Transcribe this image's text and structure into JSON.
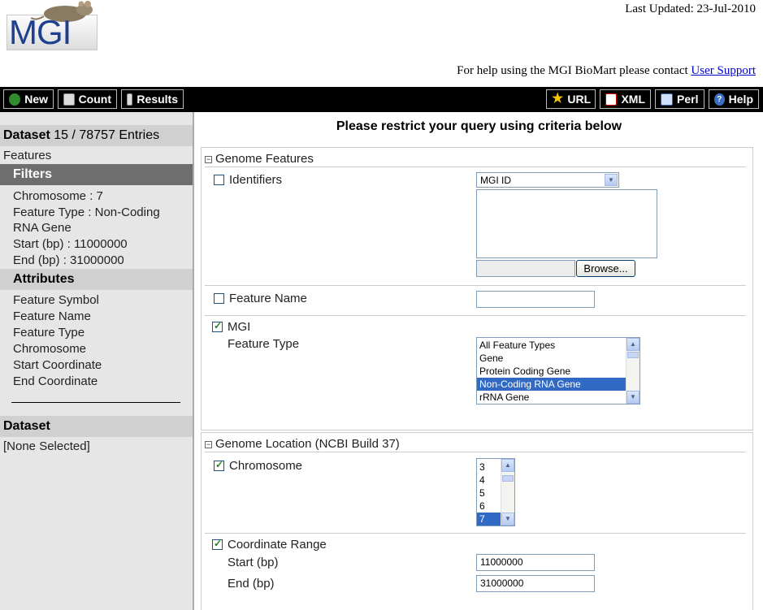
{
  "header": {
    "logo_text": "MGI",
    "last_updated": "Last Updated: 23-Jul-2010",
    "help_prefix": "For help using the MGI BioMart please contact",
    "help_link": "User Support"
  },
  "toolbar": {
    "new": "New",
    "count": "Count",
    "results": "Results",
    "url": "URL",
    "xml": "XML",
    "perl": "Perl",
    "help": "Help"
  },
  "sidebar": {
    "dataset_label": "Dataset",
    "dataset_count": "15 / 78757 Entries",
    "dataset_name": "Features",
    "filters_header": "Filters",
    "filters": [
      "Chromosome : 7",
      "Feature Type : Non-Coding",
      "RNA Gene",
      "Start (bp) : 11000000",
      "End (bp) : 31000000"
    ],
    "attributes_header": "Attributes",
    "attributes": [
      "Feature Symbol",
      "Feature Name",
      "Feature Type",
      "Chromosome",
      "Start Coordinate",
      "End Coordinate"
    ],
    "dataset2_header": "Dataset",
    "dataset2_value": "[None Selected]"
  },
  "main": {
    "title": "Please restrict your query using criteria below",
    "genome_features": {
      "header": "Genome Features",
      "identifiers_label": "Identifiers",
      "identifiers_select": "MGI ID",
      "browse_button": "Browse...",
      "feature_name_label": "Feature Name",
      "mgi_label": "MGI",
      "feature_type_label": "Feature Type",
      "feature_type_options": [
        "All Feature Types",
        "Gene",
        "Protein Coding Gene",
        "Non-Coding RNA Gene",
        "rRNA Gene"
      ]
    },
    "genome_location": {
      "header": "Genome Location (NCBI Build 37)",
      "chromosome_label": "Chromosome",
      "chromosome_options": [
        "3",
        "4",
        "5",
        "6",
        "7"
      ],
      "coord_label": "Coordinate Range",
      "start_label": "Start (bp)",
      "start_value": "11000000",
      "end_label": "End (bp)",
      "end_value": "31000000"
    }
  }
}
